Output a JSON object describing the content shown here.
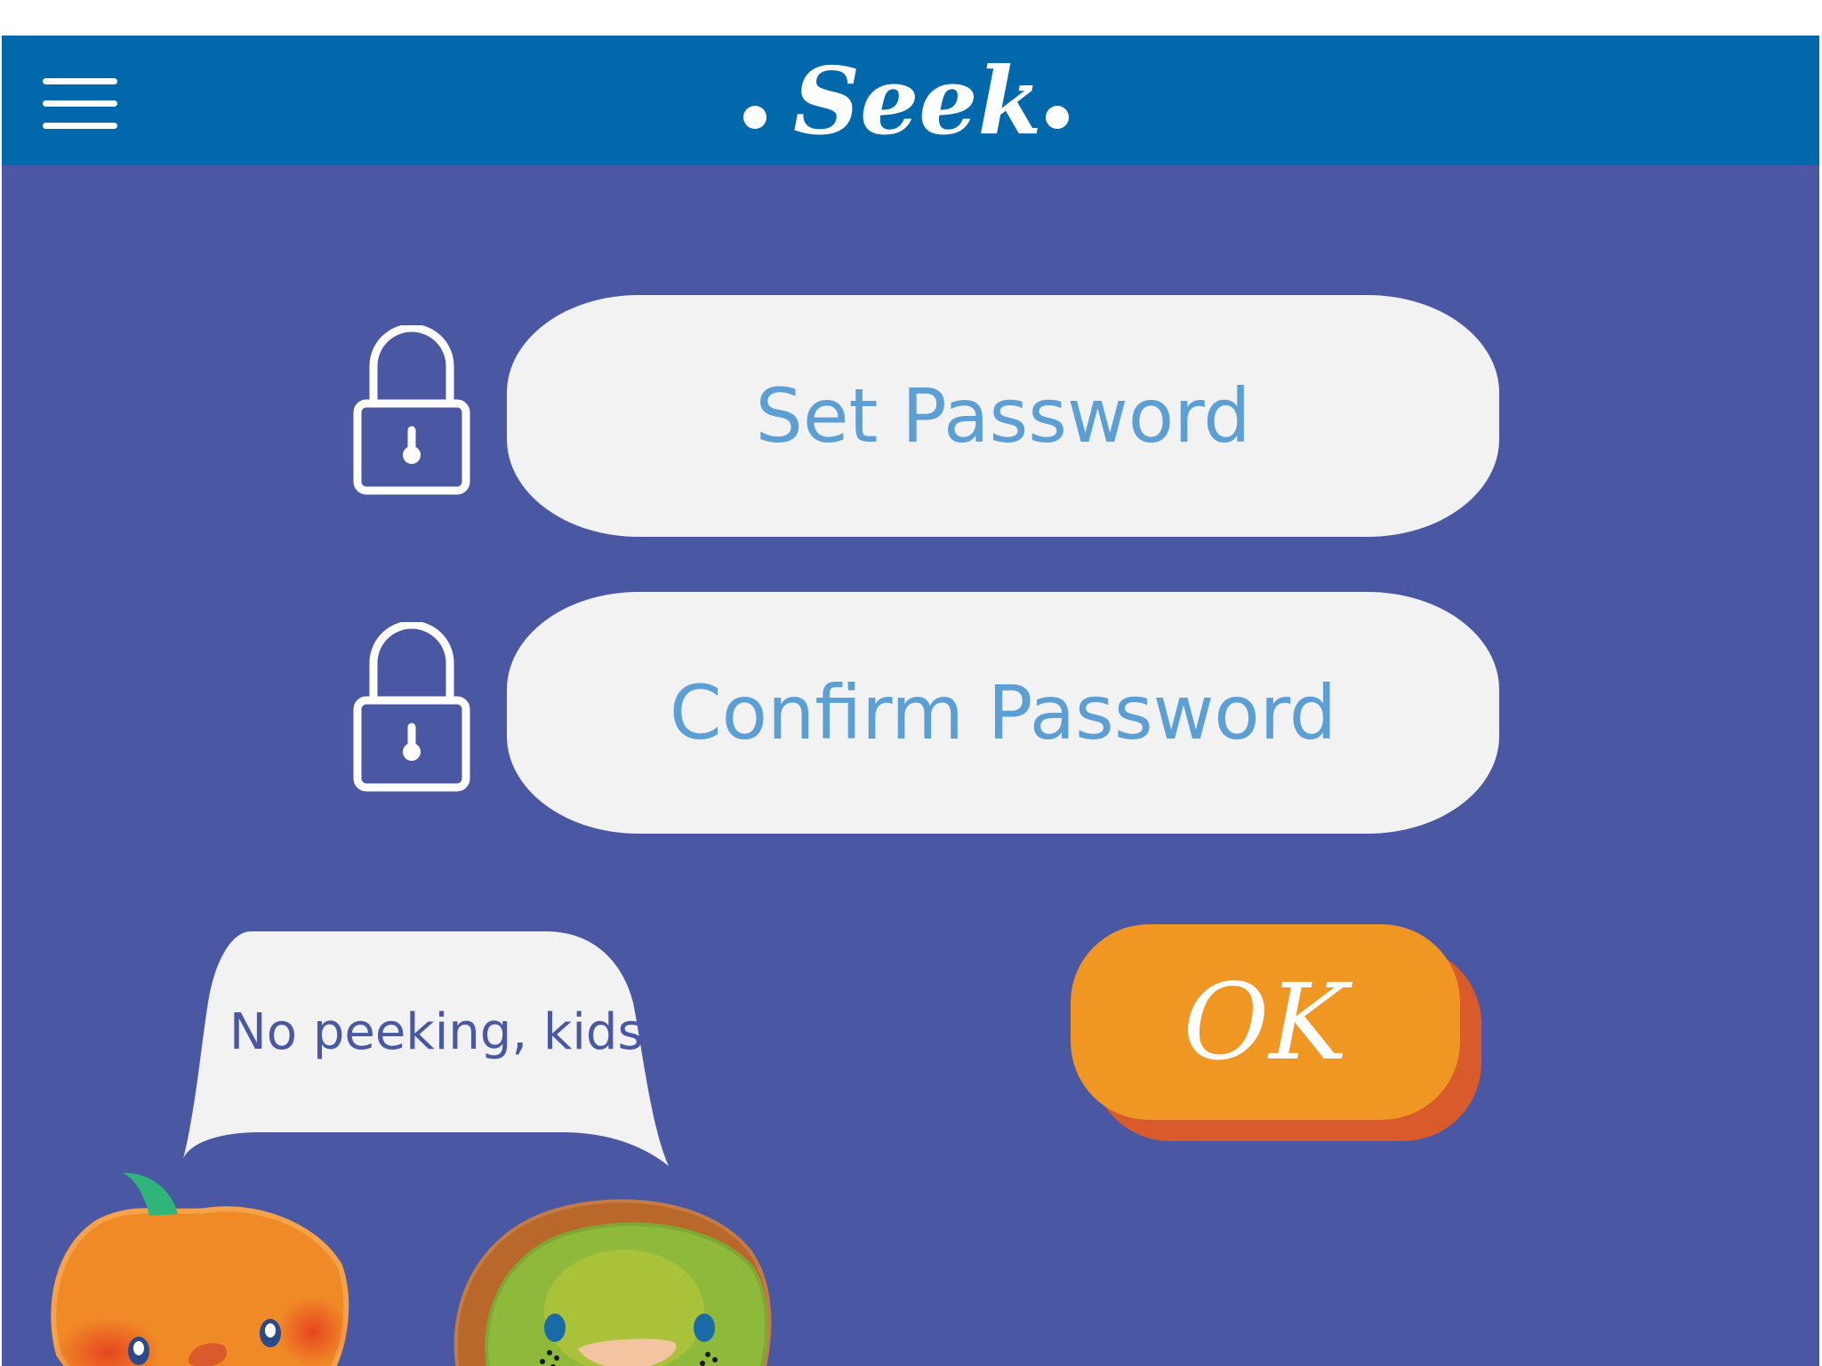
{
  "header": {
    "title": "Seek",
    "menu_icon": "hamburger-menu-icon"
  },
  "form": {
    "set_password": {
      "placeholder": "Set Password",
      "icon": "lock-icon"
    },
    "confirm_password": {
      "placeholder": "Confirm Password",
      "icon": "lock-icon"
    },
    "ok_label": "OK"
  },
  "mascots": {
    "speech": "No peeking, kids!",
    "characters": [
      "orange-mascot",
      "kiwi-mascot"
    ]
  },
  "colors": {
    "header_bg": "#0068ab",
    "page_bg": "#4a58a4",
    "field_bg": "#f2f2f2",
    "field_text": "#5b9fd4",
    "ok_button": "#ef9623",
    "ok_button_shadow": "#d95a2a"
  }
}
